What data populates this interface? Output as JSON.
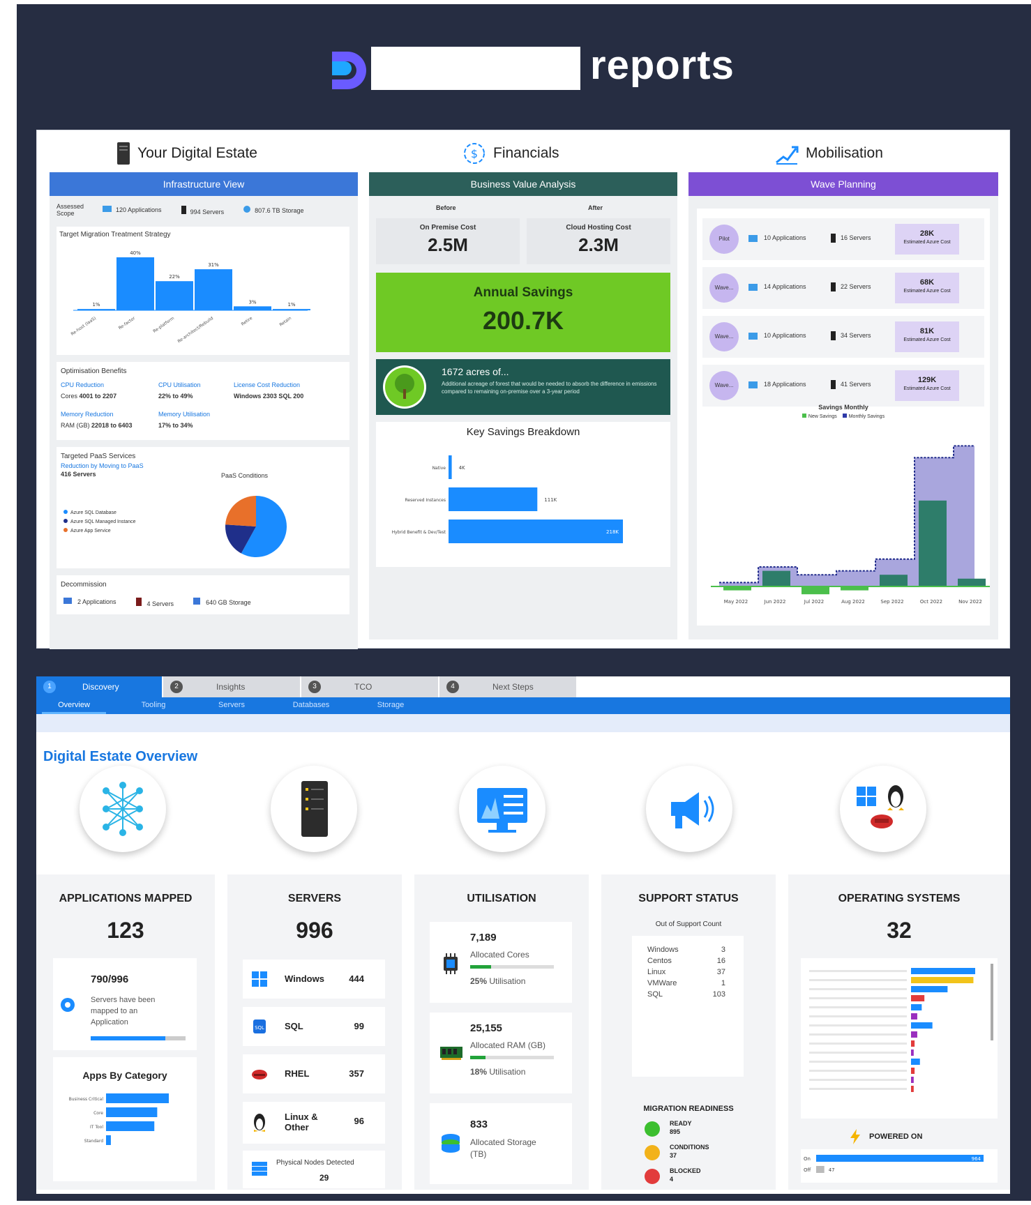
{
  "header": {
    "logo_text": "reports",
    "logo_icon": "brand-d-icon",
    "accent": "#6a5bff"
  },
  "estate": {
    "title": "Your Digital Estate",
    "band": "Infrastructure View",
    "scope_label": "Assessed Scope",
    "scope_items": [
      "120 Applications",
      "994 Servers",
      "807.6 TB Storage"
    ],
    "strategy_title": "Target Migration Treatment Strategy",
    "strategy_chart": {
      "type": "bar",
      "categories": [
        "Re-host (IaaS)",
        "Re-factor",
        "Re-platform",
        "Re-architect/Rebuild",
        "Retire",
        "Retain"
      ],
      "values": [
        1,
        40,
        22,
        31,
        3,
        1
      ],
      "value_labels": [
        "1%",
        "40%",
        "22%",
        "31%",
        "3%",
        "1%"
      ]
    },
    "opt_title": "Optimisation Benefits",
    "opt": [
      {
        "label": "CPU Reduction",
        "value": "4001 to 2207",
        "sub": "Cores"
      },
      {
        "label": "CPU Utilisation",
        "value": "22% to 49%"
      },
      {
        "label": "License Cost Reduction",
        "value": "Windows 2303 SQL 200"
      },
      {
        "label": "Memory Reduction",
        "value": "22018 to 6403",
        "sub": "RAM (GB)"
      },
      {
        "label": "Memory Utilisation",
        "value": "17% to 34%"
      }
    ],
    "paas_title": "Targeted PaaS Services",
    "paas_sub": "Reduction by Moving to PaaS",
    "paas_count": "416 Servers",
    "paas_chart_title": "PaaS Conditions",
    "paas_pie": {
      "type": "pie",
      "labels": [
        "Azure SQL Database",
        "Azure SQL Managed Instance",
        "Azure App Service"
      ],
      "values": [
        58,
        18,
        24
      ],
      "colors": [
        "#1a8cff",
        "#1f2f8a",
        "#e8702a"
      ]
    },
    "decom_title": "Decommission",
    "decom_items": [
      "2 Applications",
      "4 Servers",
      "640 GB Storage"
    ]
  },
  "financials": {
    "title": "Financials",
    "band": "Business Value Analysis",
    "before_label": "Before",
    "after_label": "After",
    "onprem_label": "On Premise Cost",
    "onprem_value": "2.5M",
    "cloud_label": "Cloud Hosting Cost",
    "cloud_value": "2.3M",
    "savings_label": "Annual Savings",
    "savings_value": "200.7K",
    "acres_title": "1672 acres of...",
    "acres_text": "Additional acreage of forest that would be needed to absorb the difference in emissions compared to remaining on-premise over a 3-year period",
    "key_title": "Key Savings Breakdown",
    "key_chart": {
      "type": "bar",
      "categories": [
        "Native",
        "Reserved Instances",
        "Hybrid Benefit & Dev/Test"
      ],
      "values": [
        4,
        111,
        218
      ],
      "value_labels": [
        "4K",
        "111K",
        "218K"
      ]
    }
  },
  "mobilisation": {
    "title": "Mobilisation",
    "band": "Wave Planning",
    "waves": [
      {
        "badge": "Pilot",
        "apps": "10 Applications",
        "servers": "16 Servers",
        "cost": "28K",
        "cost_label": "Estimated Azure Cost"
      },
      {
        "badge": "Wave...",
        "apps": "14 Applications",
        "servers": "22 Servers",
        "cost": "68K",
        "cost_label": "Estimated Azure Cost"
      },
      {
        "badge": "Wave...",
        "apps": "10 Applications",
        "servers": "34 Servers",
        "cost": "81K",
        "cost_label": "Estimated Azure Cost"
      },
      {
        "badge": "Wave...",
        "apps": "18 Applications",
        "servers": "41 Servers",
        "cost": "129K",
        "cost_label": "Estimated Azure Cost"
      }
    ],
    "savings_title": "Savings Monthly",
    "savings_legend": [
      "New Savings",
      "Monthly Savings"
    ],
    "savings_chart": {
      "type": "area",
      "categories": [
        "May 2022",
        "Jun 2022",
        "Jul 2022",
        "Aug 2022",
        "Sep 2022",
        "Oct 2022",
        "Nov 2022"
      ],
      "monthly": [
        1,
        5,
        3,
        4,
        7,
        33,
        36
      ],
      "new": [
        -1,
        4,
        -2,
        -1,
        3,
        22,
        2
      ]
    }
  },
  "tabs": [
    {
      "num": "1",
      "label": "Discovery"
    },
    {
      "num": "2",
      "label": "Insights"
    },
    {
      "num": "3",
      "label": "TCO"
    },
    {
      "num": "4",
      "label": "Next Steps"
    }
  ],
  "subtabs": [
    "Overview",
    "Tooling",
    "Servers",
    "Databases",
    "Storage"
  ],
  "overview": {
    "title": "Digital Estate Overview",
    "icons": [
      "network-nodes-icon",
      "server-icon",
      "monitor-dashboard-icon",
      "megaphone-icon",
      "os-logos-icon"
    ],
    "apps": {
      "title": "APPLICATIONS MAPPED",
      "value": "123",
      "mapped": "790/996",
      "mapped_text": "Servers have been mapped to an Application",
      "mapped_fraction": 0.79,
      "cat_title": "Apps By Category",
      "cat_chart": {
        "type": "bar",
        "categories": [
          "Business Critical",
          "Core",
          "IT Tool",
          "Standard"
        ],
        "values": [
          65,
          53,
          50,
          5
        ]
      }
    },
    "servers": {
      "title": "SERVERS",
      "value": "996",
      "rows": [
        {
          "label": "Windows",
          "value": "444",
          "icon": "windows-icon"
        },
        {
          "label": "SQL",
          "value": "99",
          "icon": "sql-icon"
        },
        {
          "label": "RHEL",
          "value": "357",
          "icon": "redhat-icon"
        },
        {
          "label": "Linux & Other",
          "value": "96",
          "icon": "linux-icon"
        }
      ],
      "nodes_label": "Physical Nodes Detected",
      "nodes_value": "29"
    },
    "util": {
      "title": "UTILISATION",
      "cores_value": "7,189",
      "cores_label": "Allocated Cores",
      "cores_util": "25%",
      "cores_util_label": "Utilisation",
      "cores_fraction": 0.25,
      "ram_value": "25,155",
      "ram_label": "Allocated RAM (GB)",
      "ram_util": "18%",
      "ram_util_label": "Utilisation",
      "ram_fraction": 0.18,
      "storage_value": "833",
      "storage_label": "Allocated Storage (TB)"
    },
    "support": {
      "title": "SUPPORT STATUS",
      "sub": "Out of Support Count",
      "rows": [
        {
          "label": "Windows",
          "value": "3"
        },
        {
          "label": "Centos",
          "value": "16"
        },
        {
          "label": "Linux",
          "value": "37"
        },
        {
          "label": "VMWare",
          "value": "1"
        },
        {
          "label": "SQL",
          "value": "103"
        }
      ],
      "readiness_title": "MIGRATION READINESS",
      "readiness": [
        {
          "label": "READY",
          "value": "895",
          "color": "#3cbf2f"
        },
        {
          "label": "CONDITIONS",
          "value": "37",
          "color": "#f2b21a"
        },
        {
          "label": "BLOCKED",
          "value": "4",
          "color": "#e23c3c"
        }
      ]
    },
    "os": {
      "title": "OPERATING SYSTEMS",
      "value": "32",
      "os_chart": {
        "type": "bar",
        "values": [
          72,
          70,
          41,
          15,
          12,
          7,
          24,
          7,
          4,
          3,
          10,
          4,
          3,
          3
        ]
      },
      "powered_title": "POWERED ON",
      "powered_chart": {
        "type": "bar",
        "categories": [
          "On",
          "Off"
        ],
        "values": [
          964,
          47
        ],
        "value_labels": [
          "964",
          "47"
        ]
      }
    }
  }
}
